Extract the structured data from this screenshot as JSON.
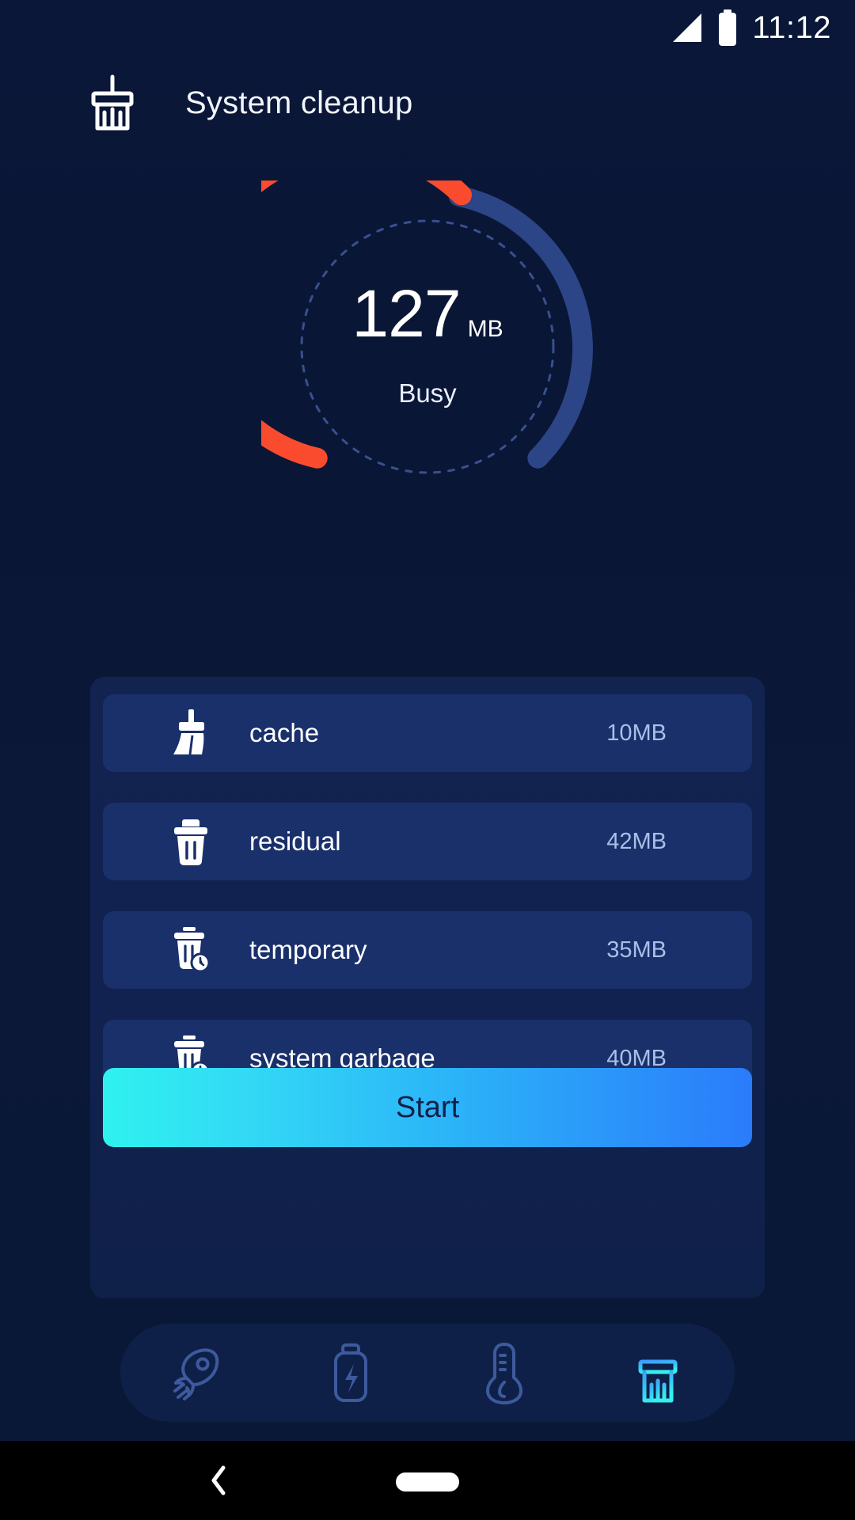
{
  "status_bar": {
    "time": "11:12",
    "signal_icon": "signal-triangle-icon",
    "battery_icon": "battery-full-icon"
  },
  "header": {
    "title": "System cleanup",
    "icon": "broom-icon"
  },
  "gauge": {
    "value": "127",
    "unit": "MB",
    "status": "Busy",
    "used_color": "#fa4b2f",
    "track_color": "#2c4586",
    "used_fraction": 0.62,
    "dotted_ring": true
  },
  "items": [
    {
      "label": "cache",
      "size": "10MB",
      "icon": "broom-sweep-icon"
    },
    {
      "label": "residual",
      "size": "42MB",
      "icon": "trash-icon"
    },
    {
      "label": "temporary",
      "size": "35MB",
      "icon": "trash-clock-icon"
    },
    {
      "label": "system garbage",
      "size": "40MB",
      "icon": "trash-clock-icon"
    }
  ],
  "action": {
    "start_label": "Start",
    "gradient_from": "#2ff2ef",
    "gradient_to": "#2b7bfb",
    "text_color": "#102048"
  },
  "bottom_nav": [
    {
      "name": "boost",
      "icon": "rocket-icon",
      "active": false
    },
    {
      "name": "battery",
      "icon": "battery-bolt-icon",
      "active": false
    },
    {
      "name": "cooling",
      "icon": "thermometer-icon",
      "active": false
    },
    {
      "name": "cleanup",
      "icon": "broom-icon",
      "active": true
    }
  ],
  "system_nav": {
    "back_icon": "chevron-left-icon",
    "home_icon": "home-pill-icon"
  }
}
